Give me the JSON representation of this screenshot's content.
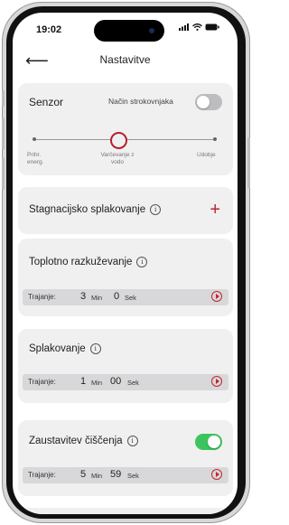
{
  "status_bar": {
    "time": "19:02"
  },
  "nav": {
    "title": "Nastavitve"
  },
  "sensor": {
    "label": "Senzor",
    "expert_mode_label": "Način strokovnjaka",
    "expert_mode_on": false,
    "slider_left": "Prihr.\nenerg.",
    "slider_middle": "Varčevanje z\nvodo",
    "slider_right": "Udobje",
    "selected": "Varčevanje z vodo"
  },
  "stagnation": {
    "label": "Stagnacijsko splakovanje",
    "info": "i"
  },
  "thermal": {
    "label": "Toplotno razkuževanje",
    "info": "i",
    "duration_label": "Trajanje:",
    "minutes": "3",
    "min_unit": "Min",
    "seconds": "0",
    "sec_unit": "Sek"
  },
  "flush": {
    "label": "Splakovanje",
    "info": "i",
    "duration_label": "Trajanje:",
    "minutes": "1",
    "min_unit": "Min",
    "seconds": "00",
    "sec_unit": "Sek"
  },
  "cleaning_stop": {
    "label": "Zaustavitev čiščenja",
    "info": "i",
    "enabled": true,
    "duration_label": "Trajanje:",
    "minutes": "5",
    "min_unit": "Min",
    "seconds": "59",
    "sec_unit": "Sek"
  },
  "colors": {
    "accent": "#c0252e",
    "toggle_on": "#3ec45f",
    "toggle_off": "#bdbdbf",
    "card": "#f0f0f1"
  }
}
